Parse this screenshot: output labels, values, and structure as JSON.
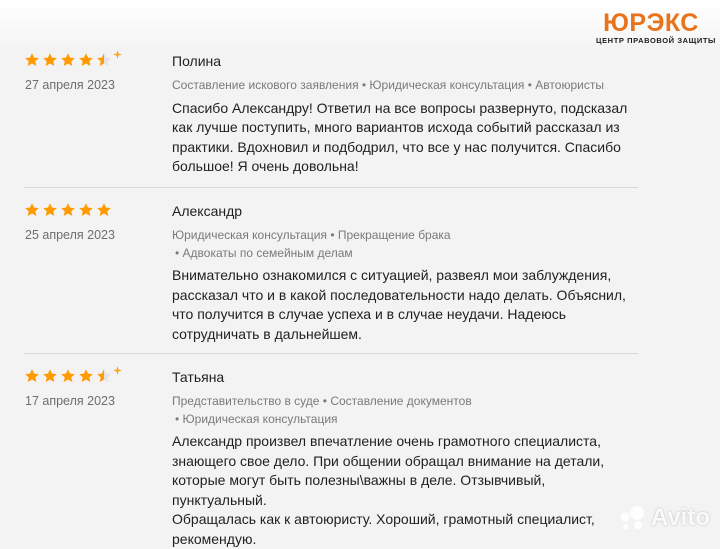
{
  "logo": {
    "name": "ЮРЭКС",
    "tagline": "ЦЕНТР ПРАВОВОЙ ЗАЩИТЫ"
  },
  "colors": {
    "star": "#ff9a00",
    "sparkle": "#ffa31a",
    "brand": "#e8731b"
  },
  "watermark": {
    "text": "Avito"
  },
  "reviews": [
    {
      "rating": 4.5,
      "date": "27 апреля 2023",
      "author": "Полина",
      "tags_line1": "Составление искового заявления • Юридическая консультация • Автоюристы",
      "tags_line2": "",
      "text": "Спасибо Александру! Ответил на все вопросы развернуто, подсказал\nкак лучше поступить, много вариантов исхода событий рассказал из\nпрактики. Вдохновил и подбодрил, что все у нас получится. Спасибо\nбольшое! Я очень довольна!"
    },
    {
      "rating": 5,
      "date": "25 апреля 2023",
      "author": "Александр",
      "tags_line1": "Юридическая консультация • Прекращение брака",
      "tags_line2": "• Адвокаты по семейным делам",
      "text": "Внимательно ознакомился с ситуацией, развеял мои заблуждения,\nрассказал что и в какой последовательности надо делать. Объяснил,\nчто получится в случае успеха и в случае неудачи. Надеюсь\nсотрудничать в дальнейшем."
    },
    {
      "rating": 4.5,
      "date": "17 апреля 2023",
      "author": "Татьяна",
      "tags_line1": "Представительство в суде • Составление документов",
      "tags_line2": "• Юридическая консультация",
      "text": "Александр произвел впечатление очень грамотного специалиста,\nзнающего свое дело. При общении обращал внимание на детали,\nкоторые могут быть полезны\\важны в деле. Отзывчивый, пунктуальный.\nОбращалась как к автоюристу. Хороший, грамотный специалист,\nрекомендую."
    }
  ]
}
